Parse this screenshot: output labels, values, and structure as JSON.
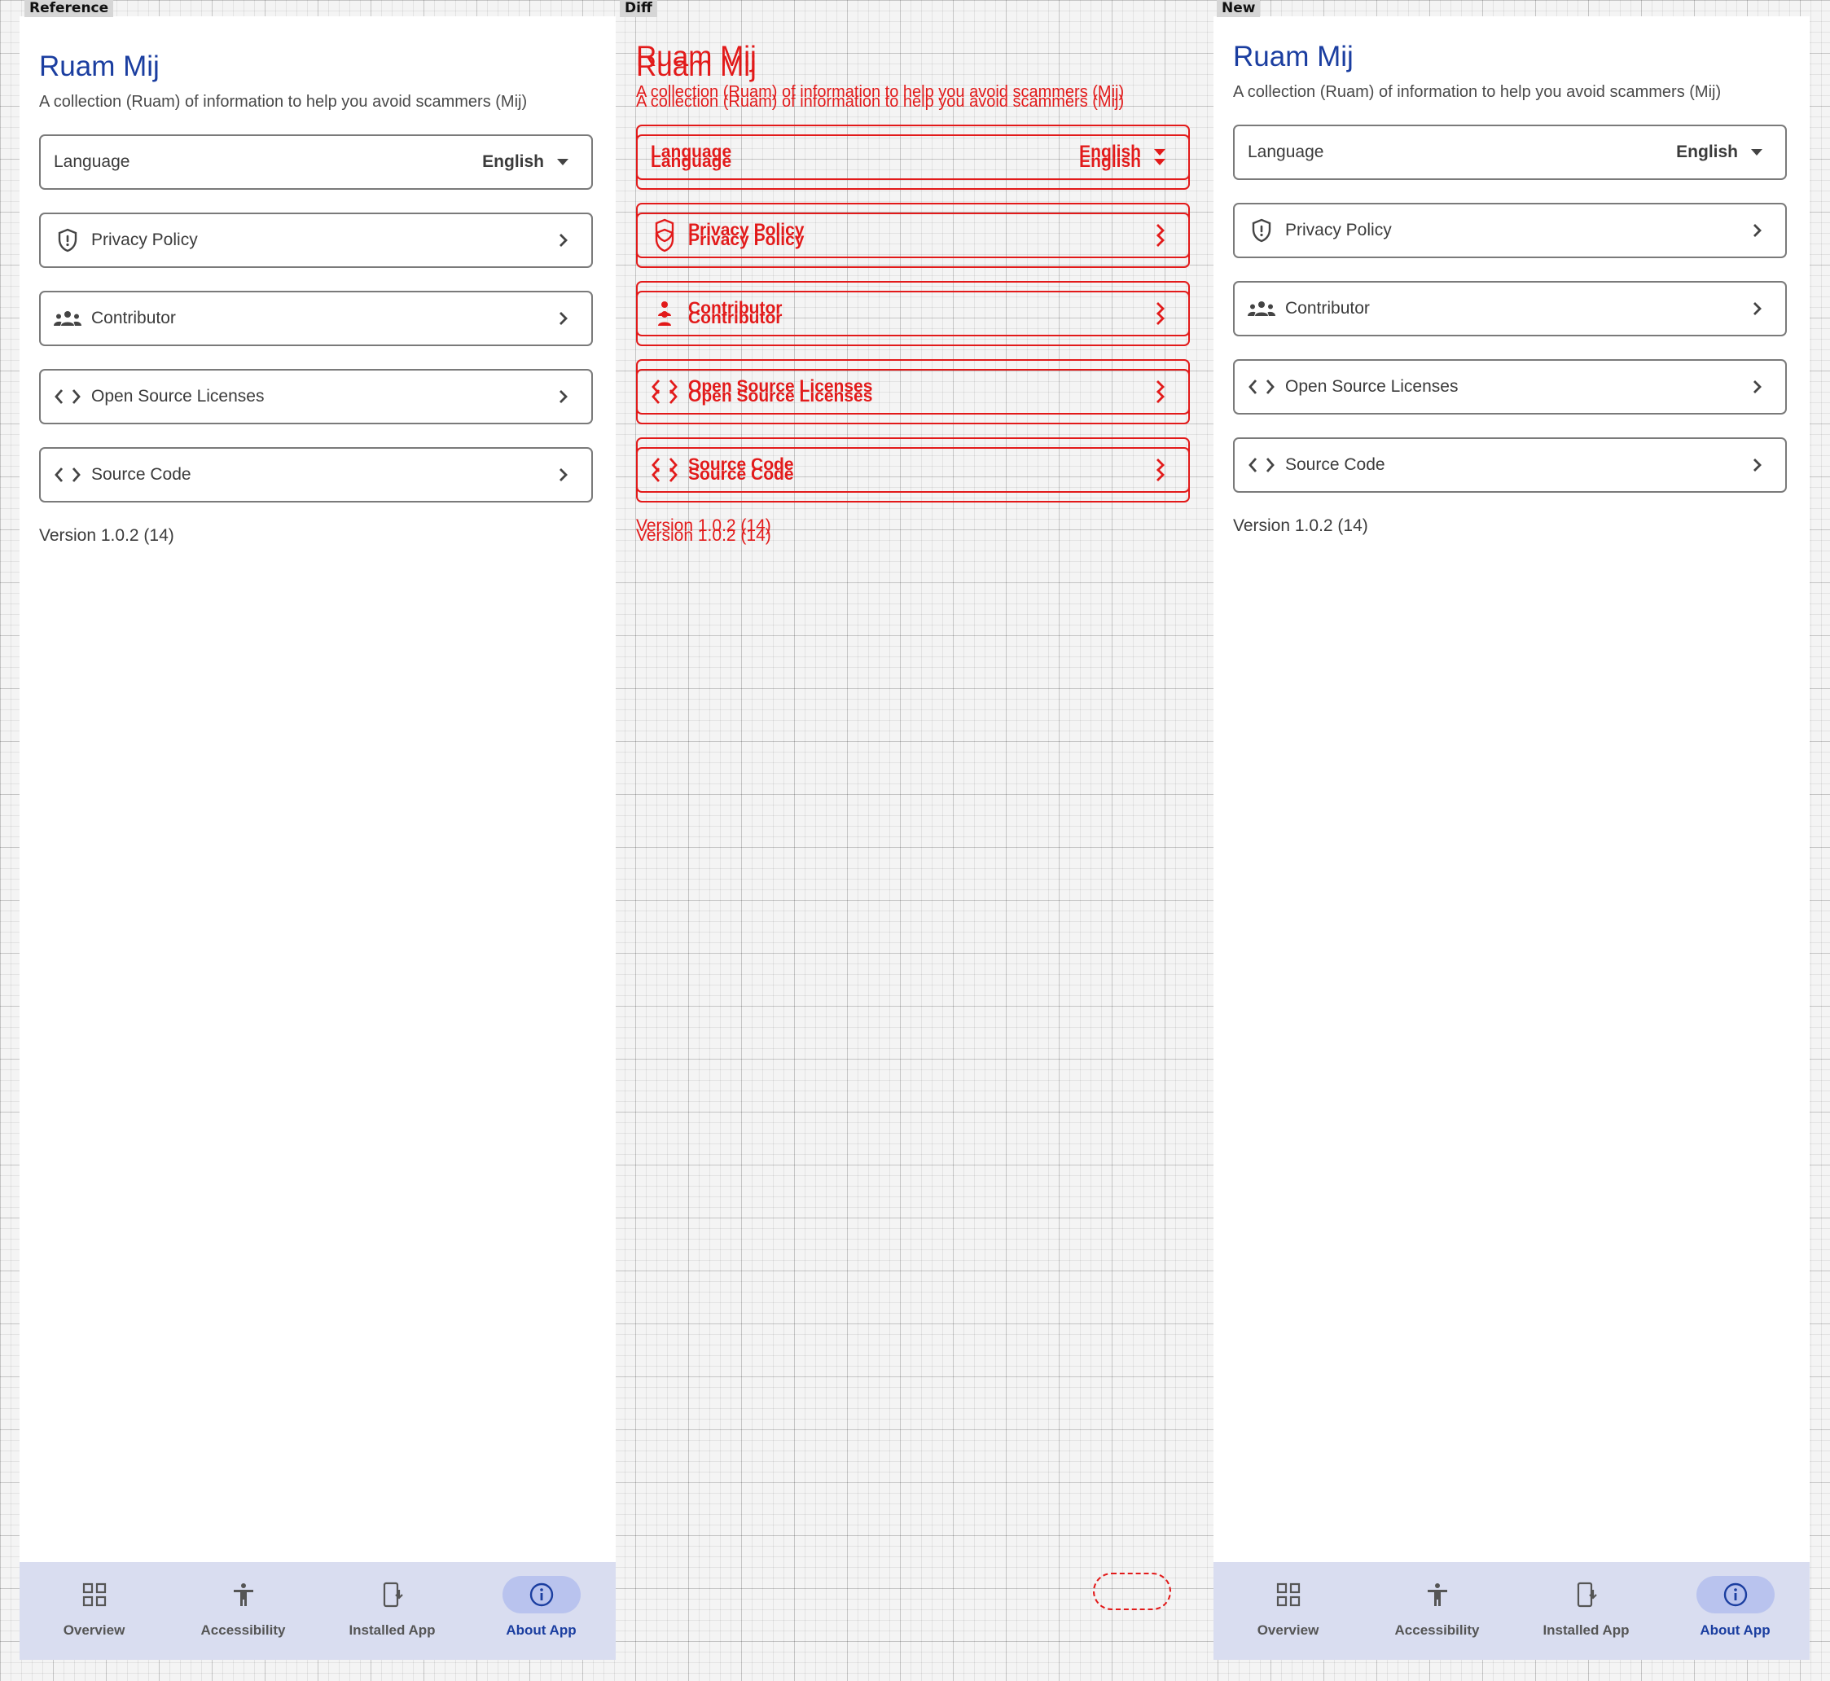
{
  "panels": {
    "reference": "Reference",
    "diff": "Diff",
    "new": "New"
  },
  "app": {
    "title": "Ruam Mij",
    "subtitle": "A collection (Ruam) of information to help you avoid scammers (Mij)",
    "version": "Version 1.0.2 (14)"
  },
  "settings": {
    "language_label": "Language",
    "language_value": "English",
    "privacy_label": "Privacy Policy",
    "contributor_label": "Contributor",
    "licenses_label": "Open Source Licenses",
    "source_label": "Source Code"
  },
  "nav": {
    "overview": "Overview",
    "accessibility": "Accessibility",
    "installed": "Installed App",
    "about": "About App"
  },
  "colors": {
    "primary": "#1b3ea0",
    "nav_background": "#d9ddf0",
    "nav_active_pill": "#b9c3ee",
    "diff": "#e21a1a"
  }
}
